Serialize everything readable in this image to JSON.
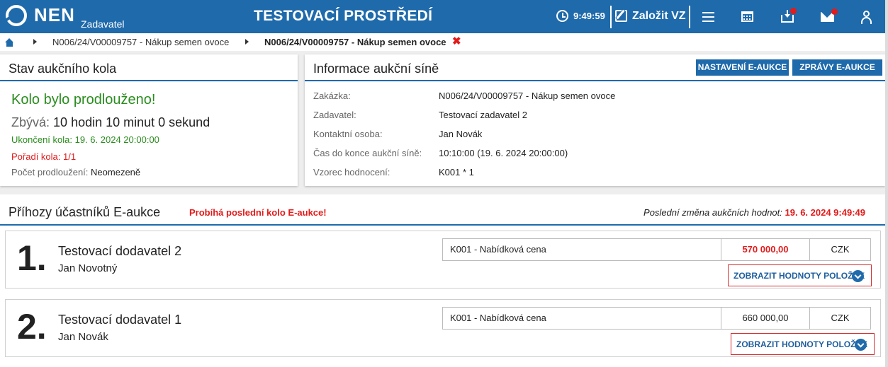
{
  "colors": {
    "brand": "#1f6aab",
    "success": "#2a8c1e",
    "alert": "#e21b1b"
  },
  "header": {
    "logo_text": "NEN",
    "logo_sub": "Zadavatel",
    "env_title": "TESTOVACÍ PROSTŘEDÍ",
    "clock": "9:49:59",
    "create_label": "Založit VZ",
    "icons": [
      "menu-icon",
      "calendar-icon",
      "inbox-icon",
      "mail-icon",
      "user-icon"
    ]
  },
  "breadcrumb": {
    "items": [
      "N006/24/V00009757 - Nákup semen ovoce"
    ],
    "current": "N006/24/V00009757 - Nákup semen ovoce",
    "close": "✖"
  },
  "round_panel": {
    "title": "Stav aukčního kola",
    "status": "Kolo bylo prodlouženo!",
    "remaining_label": "Zbývá:",
    "remaining_value": "10 hodin 10 minut 0 sekund",
    "end_label": "Ukončení kola:",
    "end_value": "19. 6. 2024 20:00:00",
    "order_label": "Pořadí kola:",
    "order_value": "1/1",
    "extensions_label": "Počet prodloužení:",
    "extensions_value": "Neomezeně"
  },
  "info_panel": {
    "title": "Informace aukční síně",
    "btn_settings": "NASTAVENÍ E-AUKCE",
    "btn_messages": "ZPRÁVY E-AUKCE",
    "rows": [
      {
        "label": "Zakázka:",
        "value": "N006/24/V00009757 - Nákup semen ovoce"
      },
      {
        "label": "Zadavatel:",
        "value": "Testovací zadavatel 2"
      },
      {
        "label": "Kontaktní osoba:",
        "value": "Jan Novák"
      },
      {
        "label": "Čas do konce aukční síně:",
        "value": "10:10:00 (19. 6. 2024 20:00:00)"
      },
      {
        "label": "Vzorec hodnocení:",
        "value": "K001 * 1"
      }
    ]
  },
  "bids": {
    "title": "Příhozy účastníků E-aukce",
    "status": "Probíhá poslední kolo E-aukce!",
    "last_change_label": "Poslední změna aukčních hodnot:",
    "last_change_value": "19. 6. 2024 9:49:49",
    "items": [
      {
        "rank": "1.",
        "supplier": "Testovací dodavatel 2",
        "contact": "Jan Novotný",
        "criterion": "K001 - Nabídková cena",
        "amount": "570 000,00",
        "currency": "CZK",
        "show_label": "ZOBRAZIT HODNOTY POLOŽEK"
      },
      {
        "rank": "2.",
        "supplier": "Testovací dodavatel 1",
        "contact": "Jan Novák",
        "criterion": "K001 - Nabídková cena",
        "amount": "660 000,00",
        "currency": "CZK",
        "show_label": "ZOBRAZIT HODNOTY POLOŽEK"
      }
    ]
  }
}
